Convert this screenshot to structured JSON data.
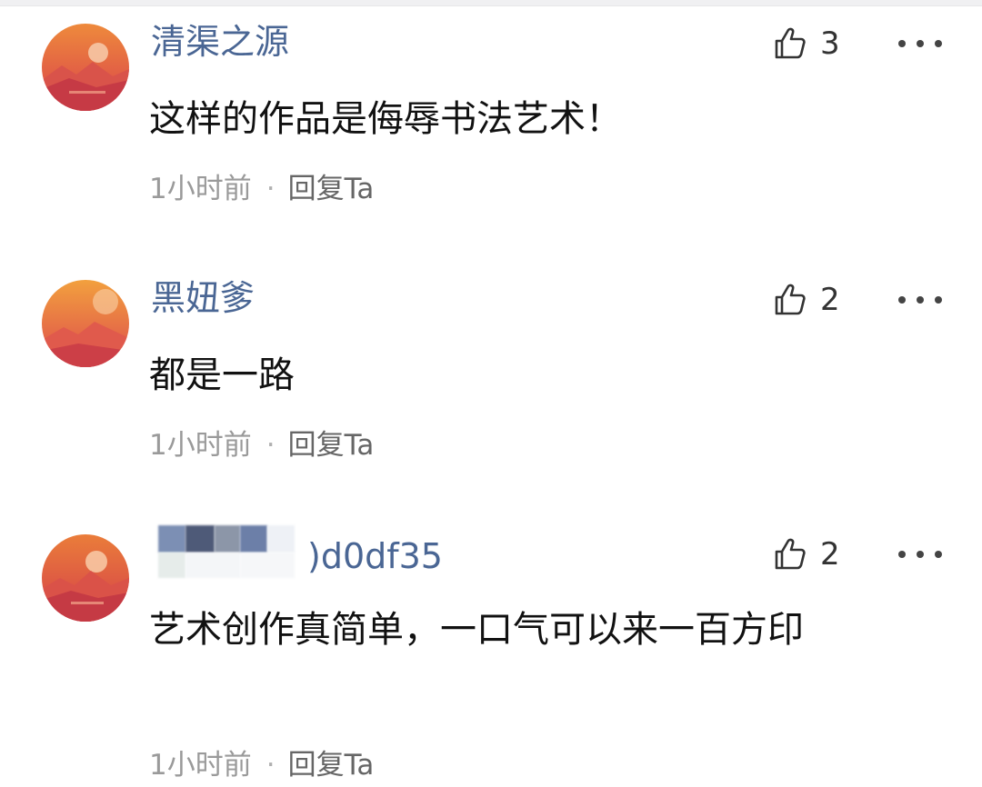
{
  "comments": [
    {
      "username": "清渠之源",
      "likes": "3",
      "text": "这样的作品是侮辱书法艺术！",
      "time": "1小时前",
      "separator": "·",
      "reply_label": "回复Ta"
    },
    {
      "username": "黑妞爹",
      "likes": "2",
      "text": "都是一路",
      "time": "1小时前",
      "separator": "·",
      "reply_label": "回复Ta"
    },
    {
      "username_visible_suffix": ")d0df35",
      "likes": "2",
      "text": "艺术创作真简单，一口气可以来一百方印",
      "time": "1小时前",
      "separator": "·",
      "reply_label": "回复Ta"
    }
  ],
  "icons": {
    "like": "thumbs-up-icon",
    "more": "more-dots-icon"
  },
  "colors": {
    "username": "#4a6694",
    "meta": "#9a9a9a",
    "text": "#111111",
    "avatar_top": "#e8833a",
    "avatar_bottom": "#d8404a"
  }
}
